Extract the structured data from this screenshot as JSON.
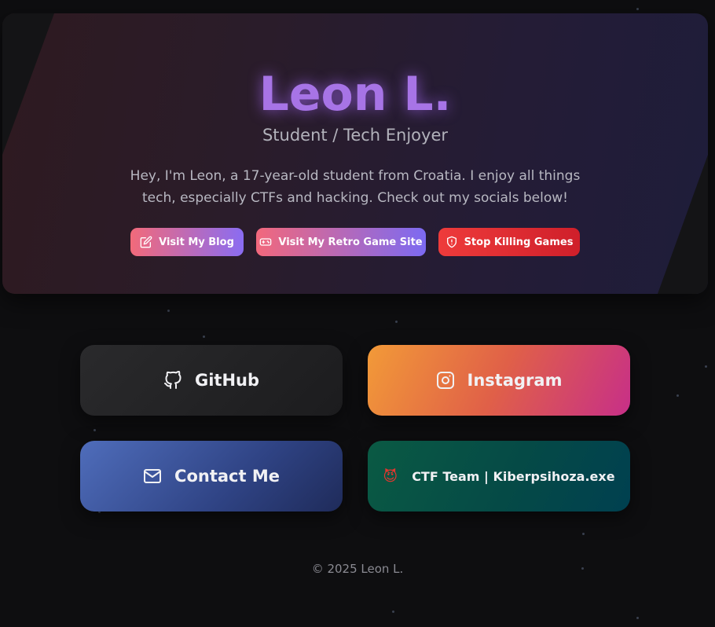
{
  "hero": {
    "title": "Leon L.",
    "subtitle": "Student / Tech Enjoyer",
    "bio": "Hey, I'm Leon, a 17-year-old student from Croatia. I enjoy all things tech, especially CTFs and hacking. Check out my socials below!",
    "buttons": [
      {
        "label": "Visit My Blog",
        "icon": "edit-icon"
      },
      {
        "label": "Visit My Retro Game Site",
        "icon": "gamepad-icon"
      },
      {
        "label": "Stop Killing Games",
        "icon": "shield-alert-icon"
      }
    ]
  },
  "links": [
    {
      "label": "GitHub",
      "icon": "github-icon"
    },
    {
      "label": "Instagram",
      "icon": "instagram-icon"
    },
    {
      "label": "Contact Me",
      "icon": "mail-icon"
    },
    {
      "label": "CTF Team | Kiberpsihoza.exe",
      "icon": "devil-emoji-icon",
      "emoji": "😈"
    }
  ],
  "footer": {
    "text": "© 2025 Leon L."
  },
  "colors": {
    "background": "#0e0e10",
    "title": "#a774e6",
    "instagram_start": "#f29a38",
    "instagram_end": "#c72f88",
    "contact": "#3c5498",
    "ctf": "#05514a",
    "danger": "#e5302f"
  }
}
